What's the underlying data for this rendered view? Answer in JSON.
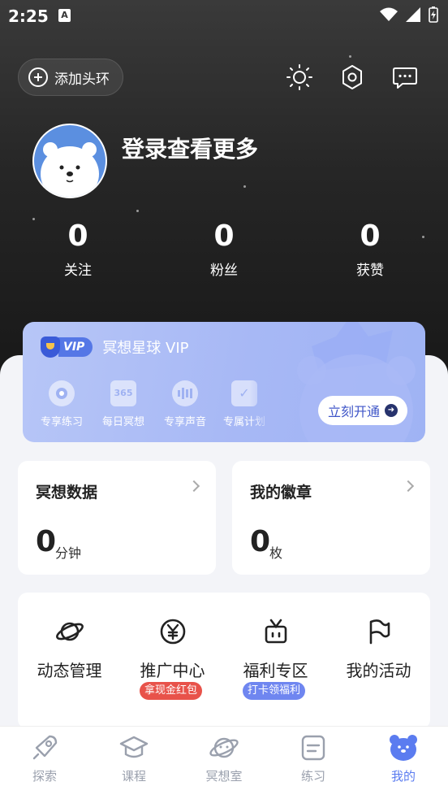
{
  "status_bar": {
    "time": "2:25",
    "notification_icon": "A"
  },
  "header": {
    "add_frame_label": "添加头环",
    "icons": [
      "theme-toggle-icon",
      "settings-icon",
      "message-icon"
    ]
  },
  "profile": {
    "login_prompt": "登录查看更多"
  },
  "stats": [
    {
      "value": "0",
      "label": "关注"
    },
    {
      "value": "0",
      "label": "粉丝"
    },
    {
      "value": "0",
      "label": "获赞"
    }
  ],
  "vip": {
    "badge": "VIP",
    "title": "冥想星球 VIP",
    "features": [
      {
        "icon": "disc-icon",
        "label": "专享练习"
      },
      {
        "icon": "calendar-365-icon",
        "label": "每日冥想"
      },
      {
        "icon": "audio-bars-icon",
        "label": "专享声音"
      },
      {
        "icon": "plan-check-icon",
        "label": "专属计划"
      }
    ],
    "cta_label": "立刻开通",
    "cta_arrow": "➜"
  },
  "cards": [
    {
      "title": "冥想数据",
      "value": "0",
      "unit": "分钟"
    },
    {
      "title": "我的徽章",
      "value": "0",
      "unit": "枚"
    }
  ],
  "menu": [
    {
      "icon": "planet-icon",
      "label": "动态管理",
      "tag": ""
    },
    {
      "icon": "yen-coin-icon",
      "label": "推广中心",
      "tag": "拿现金红包"
    },
    {
      "icon": "gift-icon",
      "label": "福利专区",
      "tag": "打卡领福利"
    },
    {
      "icon": "flag-icon",
      "label": "我的活动",
      "tag": ""
    }
  ],
  "tabbar": [
    {
      "icon": "rocket-icon",
      "label": "探索"
    },
    {
      "icon": "graduation-cap-icon",
      "label": "课程"
    },
    {
      "icon": "planet-tab-icon",
      "label": "冥想室"
    },
    {
      "icon": "notebook-icon",
      "label": "练习"
    },
    {
      "icon": "bear-face-icon",
      "label": "我的",
      "active": true
    }
  ],
  "colors": {
    "accent": "#5b7cf0",
    "promo_tag": "#e8524a",
    "welfare_tag": "#6f86f0",
    "vip_gradient_start": "#b7c6f7",
    "vip_gradient_end": "#9fb3f4"
  }
}
